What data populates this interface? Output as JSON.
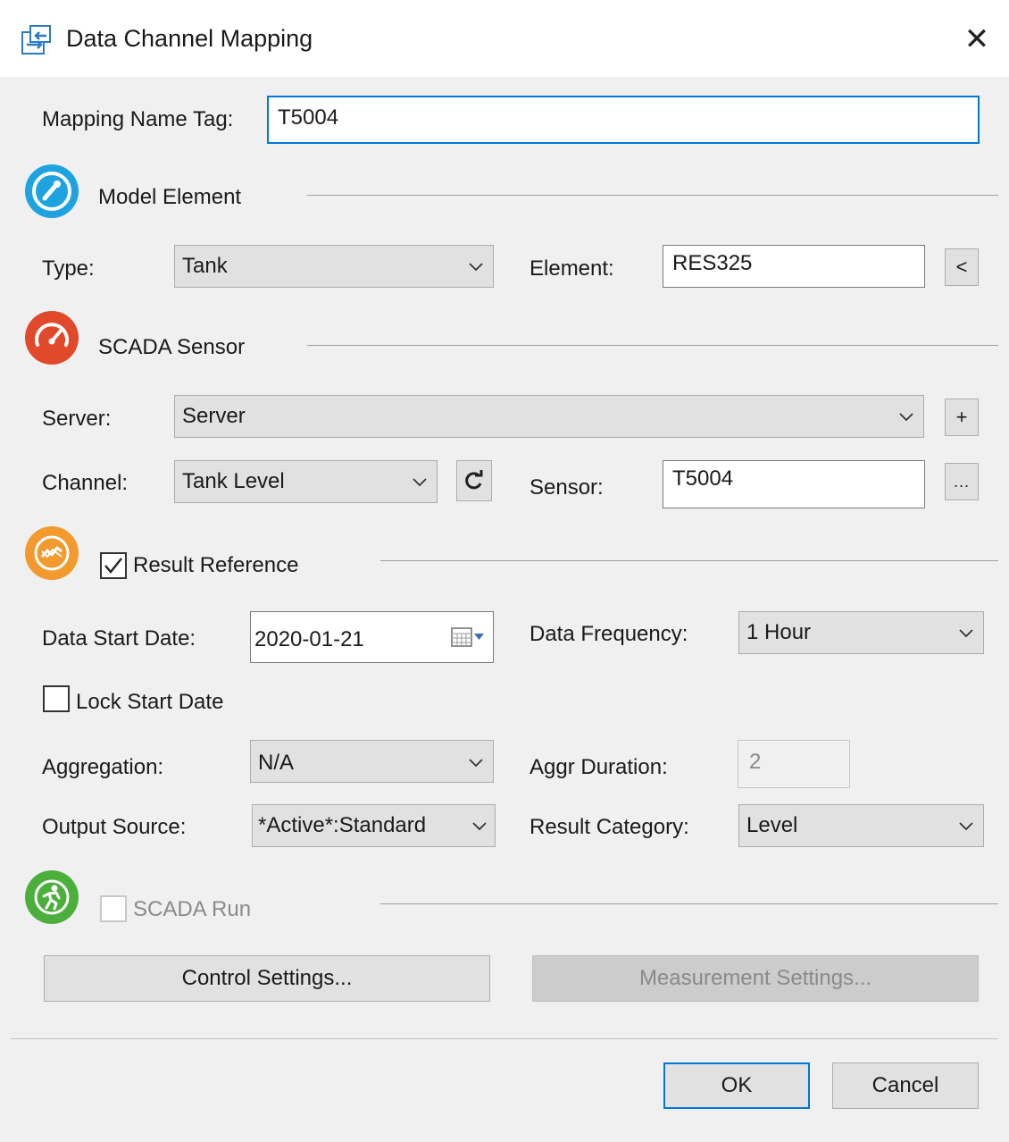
{
  "window": {
    "title": "Data Channel Mapping",
    "close_glyph": "✕",
    "icon": "data-mapping-icon"
  },
  "mapping_name": {
    "label": "Mapping Name Tag:",
    "value": "T5004"
  },
  "model_element": {
    "heading": "Model Element",
    "icon": "valve-icon",
    "icon_color": "#1fa3e0",
    "type_label": "Type:",
    "type_value": "Tank",
    "element_label": "Element:",
    "element_value": "RES325",
    "pick_button": "<"
  },
  "scada_sensor": {
    "heading": "SCADA Sensor",
    "icon": "gauge-icon",
    "icon_color": "#e04a2b",
    "server_label": "Server:",
    "server_value": "Server",
    "add_button": "+",
    "channel_label": "Channel:",
    "channel_value": "Tank Level",
    "refresh_glyph": "C",
    "sensor_label": "Sensor:",
    "sensor_value": "T5004",
    "browse_button": "..."
  },
  "result_reference": {
    "label": "Result Reference",
    "checked": true,
    "icon": "trend-chart-icon",
    "icon_color": "#f29a2e",
    "start_date_label": "Data Start Date:",
    "start_date_value": "2020-01-21",
    "frequency_label": "Data Frequency:",
    "frequency_value": "1 Hour",
    "lock_label": "Lock Start Date",
    "lock_checked": false,
    "aggregation_label": "Aggregation:",
    "aggregation_value": "N/A",
    "aggr_duration_label": "Aggr Duration:",
    "aggr_duration_value": "2",
    "output_source_label": "Output Source:",
    "output_source_value": "*Active*:Standard",
    "result_category_label": "Result Category:",
    "result_category_value": "Level"
  },
  "scada_run": {
    "label": "SCADA Run",
    "checked": false,
    "icon": "runner-icon",
    "icon_color": "#4caf3c",
    "control_settings": "Control Settings...",
    "measurement_settings": "Measurement Settings..."
  },
  "footer": {
    "ok": "OK",
    "cancel": "Cancel"
  }
}
